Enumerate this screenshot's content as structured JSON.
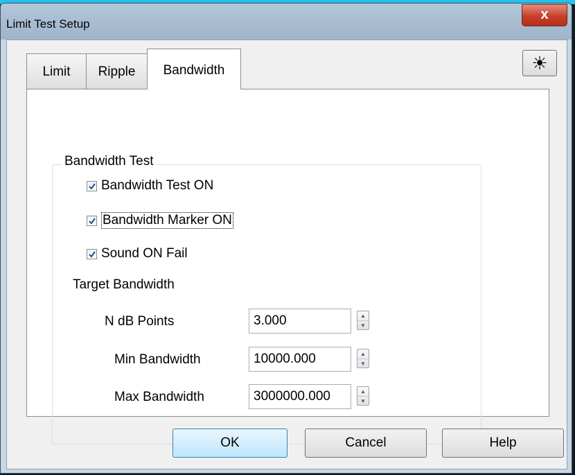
{
  "window": {
    "title": "Limit Test Setup",
    "close_glyph": "x"
  },
  "tabs": [
    {
      "label": "Limit",
      "active": false
    },
    {
      "label": "Ripple",
      "active": false
    },
    {
      "label": "Bandwidth",
      "active": true
    }
  ],
  "toolbar": {
    "sun_icon": "sun-icon",
    "sun_glyph": "☀"
  },
  "group": {
    "title": "Bandwidth Test",
    "checkboxes": [
      {
        "label": "Bandwidth Test ON",
        "checked": true
      },
      {
        "label": "Bandwidth Marker ON",
        "checked": true
      },
      {
        "label": "Sound ON Fail",
        "checked": true
      }
    ],
    "target_label": "Target Bandwidth",
    "fields": [
      {
        "label": "N dB Points",
        "value": "3.000"
      },
      {
        "label": "Min Bandwidth",
        "value": "10000.000"
      },
      {
        "label": "Max Bandwidth",
        "value": "3000000.000"
      }
    ]
  },
  "buttons": {
    "ok": "OK",
    "cancel": "Cancel",
    "help": "Help"
  },
  "colors": {
    "title_accent": "#22c3ee",
    "close": "#c6402a",
    "default_button": "#bee6fd"
  }
}
